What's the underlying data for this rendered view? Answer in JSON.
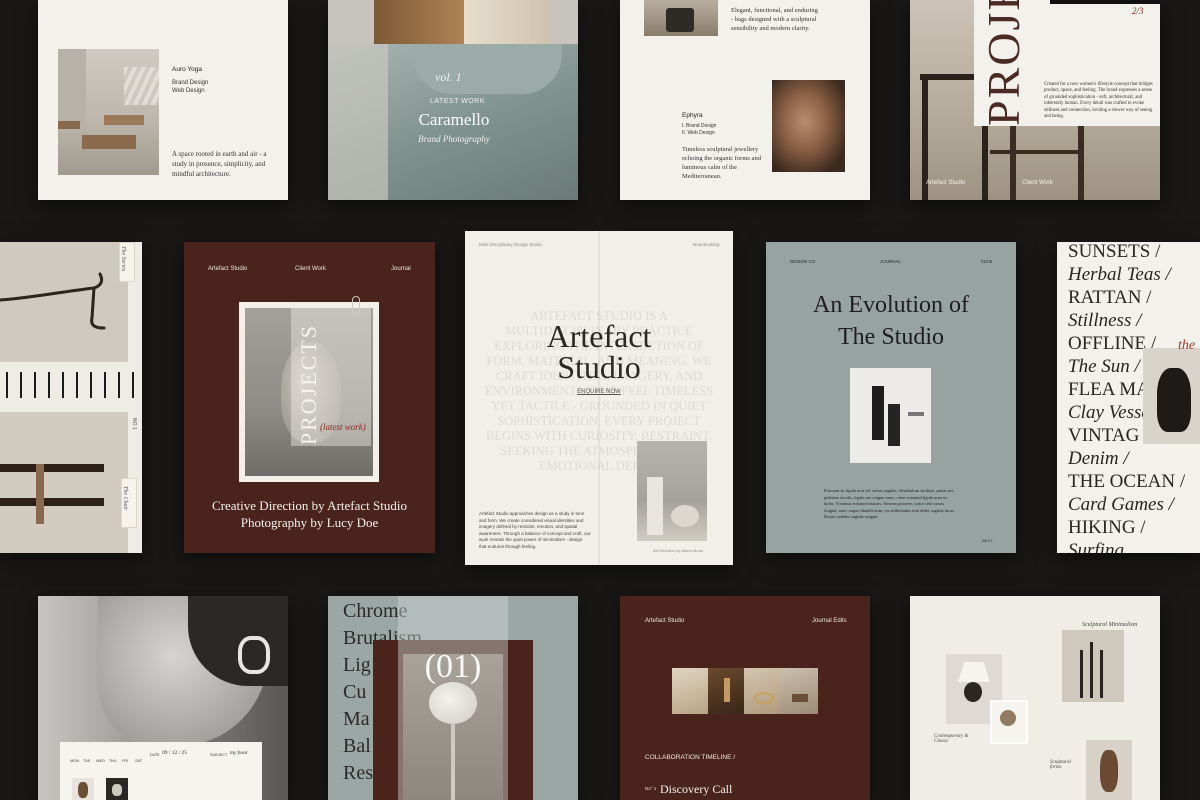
{
  "cards": {
    "auro": {
      "title": "Auro Yoga",
      "line1": "Brand Design",
      "line2": "Web Design",
      "desc": "A space rooted in earth and air - a study in presence, simplicity, and mindful architecture."
    },
    "caramello": {
      "vol": "vol. 1",
      "kicker": "LATEST WORK",
      "title": "Caramello",
      "subtitle": "Brand Photography"
    },
    "ephyra": {
      "top_text": "Elegant, functional, and enduring - bags designed with a sculptural sensibility and modern clarity.",
      "title": "Ephyra",
      "line1": "I. Brand Design",
      "line2": "II. Web Design",
      "desc": "Timeless sculptural jewellery echoing the organic forms and luminous calm of the Mediterranean."
    },
    "project_top": {
      "word": "PROJE",
      "number": "2/3",
      "desc": "Created for a new women's lifestyle concept that bridges product, space, and feeling. The brand expresses a sense of grounded sophistication - soft, architectural, and inherently human. Every detail was crafted to evoke stillness and connection, inviting a slower way of seeing and being.",
      "footer_left": "Artefact Studio",
      "footer_mid": "Client Work"
    },
    "left_mid": {
      "label_top": "The Series",
      "label_bottom": "The Chair",
      "page": "NO 1"
    },
    "projects_brown": {
      "nav": [
        "Artefact Studio",
        "Client Work",
        "Journal"
      ],
      "word": "PROJECTS",
      "script": "(latest work)",
      "caption_line1": "Creative Direction by Artefact Studio",
      "caption_line2": "Photography by Lucy Doe"
    },
    "artefact": {
      "top_left": "Multi Disciplinary Design Studio",
      "top_right": "Now Booking",
      "bg_text": "ARTEFACT STUDIO IS A MULTIDISCIPLINARY PRACTICE EXPLORING THE INTERSECTION OF FORM, MATERIAL, AND MEANING. WE CRAFT IDENTITIES, IMAGERY, AND ENVIRONMENTS THAT FEEL TIMELESS YET TACTILE - GROUNDED IN QUIET SOPHISTICATION. EVERY PROJECT BEGINS WITH CURIOSITY, RESTRAINT, SEEKING THE ATMOSPHERE, AND EMOTIONAL DEPTH.",
      "title_line1": "Artefact",
      "title_line2": "Studio",
      "link": "ENQUIRE NOW",
      "body": "Artefact Studio approaches design as a study in tone and form. We create considered visual identities and imagery defined by restraint, emotion, and spatial awareness. Through a balance of concept and craft, our work reveals the quiet power of minimalism - design that endures through feeling.",
      "credit": "Art Direction by Artem Moon"
    },
    "evolution": {
      "nav": [
        "DESIGN CO",
        "JOURNAL",
        "01/06"
      ],
      "title_line1": "An Evolution of",
      "title_line2": "The Studio",
      "body": "Praesent sit ligula non vel varius sagittis. Vestibulum facilisis, purus nec pulvinar iaculis, ligula mi congue nunc, vitae euismod ligula urna in dolor. Vivamus euismod mauris. Aenean posuere, tortor sed cursus feugiat, nunc augue blandit nunc, eu sollicitudin sem dolor sagittis lacus. Donec sodales sagittis magna.",
      "page": "NEXT"
    },
    "sunsets": {
      "lines": [
        "SUNSETS /",
        "Herbal Teas /",
        "RATTAN /",
        "Stillness /",
        "OFFLINE /",
        "The Sun /",
        "FLEA MA",
        "Clay Vesse",
        "VINTAG",
        "Denim /",
        "THE OCEAN /",
        "Card Games /",
        "HIKING /",
        "Surfing"
      ],
      "script": "the"
    },
    "portrait": {
      "days": [
        "MON",
        "TUE",
        "WED",
        "THU",
        "FRI",
        "SAT"
      ],
      "date_label": "DATE",
      "date": "09 / 12 / 25",
      "subject_label": "SUBJECT",
      "subject": "my hour"
    },
    "chrome": {
      "lines": [
        "Chrome",
        "Brutalism",
        "Lig",
        "Cu",
        "Ma",
        "Bal",
        "Res"
      ],
      "number": "(01)"
    },
    "journal_brown": {
      "left": "Artefact Studio",
      "right": "Journal Edits",
      "timeline": "COLLABORATION TIMELINE /",
      "step_label": "No° 1",
      "step": "Discovery Call"
    },
    "moodboard": {
      "note1": "Sculptural Minimalism",
      "note2": "Contemporary & Classic",
      "note3": "Sculptural forms"
    }
  }
}
